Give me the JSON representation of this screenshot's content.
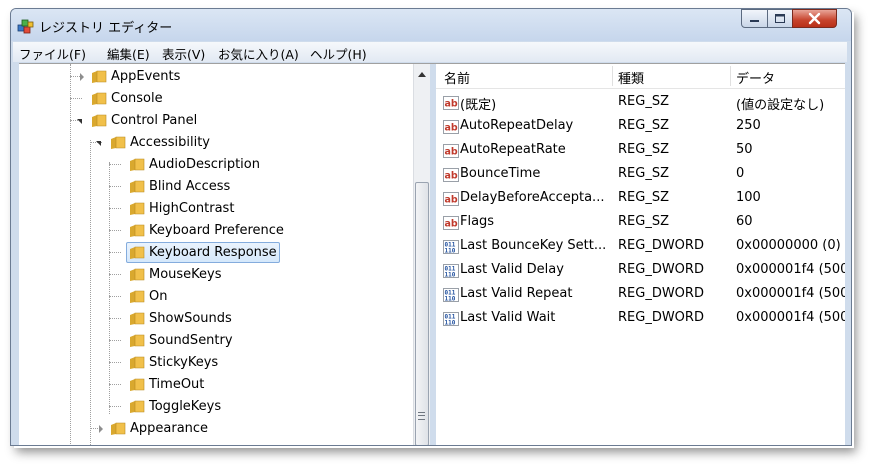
{
  "window": {
    "title": "レジストリ エディター",
    "icon": "registry-cubes-icon"
  },
  "menu": [
    "ファイル(F)",
    "編集(E)",
    "表示(V)",
    "お気に入り(A)",
    "ヘルプ(H)"
  ],
  "tree": {
    "appevents": "AppEvents",
    "console": "Console",
    "control_panel": "Control Panel",
    "accessibility": "Accessibility",
    "children": [
      "AudioDescription",
      "Blind Access",
      "HighContrast",
      "Keyboard Preference",
      "Keyboard Response",
      "MouseKeys",
      "On",
      "ShowSounds",
      "SoundSentry",
      "StickyKeys",
      "TimeOut",
      "ToggleKeys"
    ],
    "appearance": "Appearance",
    "selected": "Keyboard Response"
  },
  "list": {
    "columns": [
      "名前",
      "種類",
      "データ"
    ],
    "rows": [
      {
        "icon": "ab",
        "name": "(既定)",
        "type": "REG_SZ",
        "data": "(値の設定なし)"
      },
      {
        "icon": "ab",
        "name": "AutoRepeatDelay",
        "type": "REG_SZ",
        "data": "250"
      },
      {
        "icon": "ab",
        "name": "AutoRepeatRate",
        "type": "REG_SZ",
        "data": "50"
      },
      {
        "icon": "ab",
        "name": "BounceTime",
        "type": "REG_SZ",
        "data": "0"
      },
      {
        "icon": "ab",
        "name": "DelayBeforeAccepta...",
        "type": "REG_SZ",
        "data": "100"
      },
      {
        "icon": "ab",
        "name": "Flags",
        "type": "REG_SZ",
        "data": "60"
      },
      {
        "icon": "bin",
        "name": "Last BounceKey Sett...",
        "type": "REG_DWORD",
        "data": "0x00000000 (0)"
      },
      {
        "icon": "bin",
        "name": "Last Valid Delay",
        "type": "REG_DWORD",
        "data": "0x000001f4 (500)"
      },
      {
        "icon": "bin",
        "name": "Last Valid Repeat",
        "type": "REG_DWORD",
        "data": "0x000001f4 (500)"
      },
      {
        "icon": "bin",
        "name": "Last Valid Wait",
        "type": "REG_DWORD",
        "data": "0x000001f4 (500)"
      }
    ]
  },
  "colors": {
    "selection_fill": "#d5e8fb",
    "selection_border": "#84acdd",
    "ab_icon_red": "#c0392b",
    "bin_icon_blue": "#1f4f9e",
    "folder_yellow": "#f1c04a"
  }
}
